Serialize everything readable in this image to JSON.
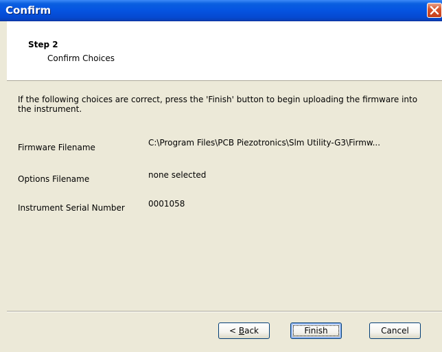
{
  "window": {
    "title": "Confirm"
  },
  "header": {
    "step": "Step 2",
    "subtitle": "Confirm Choices"
  },
  "body": {
    "intro": "If the following choices are correct, press the 'Finish' button to begin uploading the firmware into the instrument.",
    "fields": [
      {
        "label": "Firmware Filename",
        "value": "C:\\Program Files\\PCB Piezotronics\\Slm Utility-G3\\Firmw..."
      },
      {
        "label": "Options Filename",
        "value": "none selected"
      },
      {
        "label": "Instrument Serial Number",
        "value": "0001058"
      }
    ]
  },
  "buttons": {
    "back_prefix": "< ",
    "back_mnemonic": "B",
    "back_rest": "ack",
    "finish": "Finish",
    "cancel": "Cancel"
  },
  "colors": {
    "titlebar": "#0554e1",
    "close": "#d9542c",
    "face": "#ece9d8"
  },
  "icons": {
    "close": "close-icon"
  }
}
